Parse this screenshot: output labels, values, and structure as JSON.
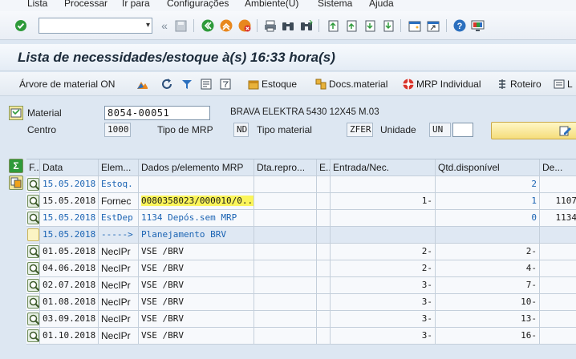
{
  "menu": [
    "Lista",
    "Processar",
    "Ir para",
    "Configurações",
    "Ambiente(U)",
    "Sistema",
    "Ajuda"
  ],
  "title": "Lista de necessidades/estoque à(s) 16:33 hora(s)",
  "app_toolbar": {
    "tree_label": "Árvore de material ON",
    "stock_label": "Estoque",
    "docs_label": "Docs.material",
    "mrp_label": "MRP Individual",
    "route_label": "Roteiro",
    "overflow_label": "L"
  },
  "header": {
    "material_label": "Material",
    "material_value": "8054-00051",
    "material_desc": "BRAVA ELEKTRA 5430 12X45 M.03",
    "centro_label": "Centro",
    "centro_value": "1000",
    "tipo_mrp_label": "Tipo de MRP",
    "tipo_mrp_value": "ND",
    "tipo_material_label": "Tipo material",
    "tipo_material_value": "ZFER",
    "unidade_label": "Unidade",
    "unidade_value": "UN"
  },
  "table": {
    "columns": [
      "F..",
      "Data",
      "Elem...",
      "Dados p/elemento MRP",
      "Dta.repro...",
      "E..",
      "Entrada/Nec.",
      "Qtd.disponível",
      "De..."
    ],
    "rows": [
      {
        "date": "15.05.2018",
        "elem": "Estoq.",
        "dados": "",
        "entrada": "",
        "qtd": "2",
        "de": "",
        "blue": true,
        "icon": "plain"
      },
      {
        "date": "15.05.2018",
        "elem": "Fornec",
        "dados": "0080358023/000010/0...",
        "entrada": "1-",
        "qtd": "1",
        "de": "1107",
        "blue": false,
        "icon": "detail"
      },
      {
        "date": "15.05.2018",
        "elem": "EstDep",
        "dados": "1134 Depós.sem MRP",
        "entrada": "",
        "qtd": "0",
        "de": "1134",
        "blue": true,
        "icon": "plain"
      },
      {
        "date": "15.05.2018",
        "elem": "----->",
        "dados": "Planejamento BRV",
        "entrada": "",
        "qtd": "",
        "de": "",
        "blue": true,
        "icon": "empty"
      },
      {
        "date": "01.05.2018",
        "elem": "NecIPr",
        "dados": "VSE /BRV",
        "entrada": "2-",
        "qtd": "2-",
        "de": "",
        "blue": false,
        "icon": "detail"
      },
      {
        "date": "04.06.2018",
        "elem": "NecIPr",
        "dados": "VSE /BRV",
        "entrada": "2-",
        "qtd": "4-",
        "de": "",
        "blue": false,
        "icon": "detail"
      },
      {
        "date": "02.07.2018",
        "elem": "NecIPr",
        "dados": "VSE /BRV",
        "entrada": "3-",
        "qtd": "7-",
        "de": "",
        "blue": false,
        "icon": "detail"
      },
      {
        "date": "01.08.2018",
        "elem": "NecIPr",
        "dados": "VSE /BRV",
        "entrada": "3-",
        "qtd": "10-",
        "de": "",
        "blue": false,
        "icon": "detail"
      },
      {
        "date": "03.09.2018",
        "elem": "NecIPr",
        "dados": "VSE /BRV",
        "entrada": "3-",
        "qtd": "13-",
        "de": "",
        "blue": false,
        "icon": "detail"
      },
      {
        "date": "01.10.2018",
        "elem": "NecIPr",
        "dados": "VSE /BRV",
        "entrada": "3-",
        "qtd": "16-",
        "de": "",
        "blue": false,
        "icon": "detail"
      }
    ]
  },
  "colors": {
    "accent_blue": "#1a63b3",
    "highlight": "#fbf55a",
    "ok_green": "#2e9a3a",
    "nav_orange": "#e8871e"
  }
}
